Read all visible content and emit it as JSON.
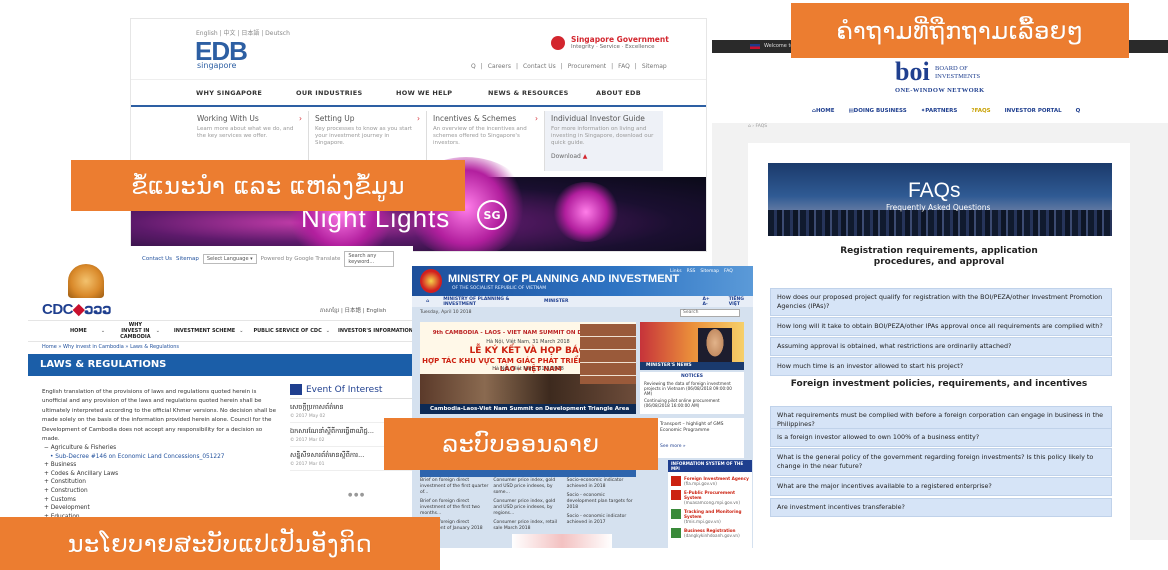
{
  "labels": {
    "faq": "ຄຳຖາມທີ່ຖືກຖາມເລື້ອຍໆ",
    "guide": "ຂໍ້ແນະນຳ ແລະ ແຫລ່ງຂໍ້ມູນ",
    "procedures": "ລະບົບອອນລາຍ",
    "policy": "ນະໂຍບາຍສະບັບແປເປັນອັງກິດ"
  },
  "edb": {
    "languages": "English | 中文 | 日本語 | Deutsch",
    "logo": "EDB",
    "logo_sub": "singapore",
    "gov_title": "Singapore Government",
    "gov_tagline": "Integrity · Service · Excellence",
    "utility_links": [
      "Q",
      "|",
      "Careers",
      "|",
      "Contact Us",
      "|",
      "Procurement",
      "|",
      "FAQ",
      "|",
      "Sitemap"
    ],
    "nav": [
      "WHY SINGAPORE",
      "OUR INDUSTRIES",
      "HOW WE HELP",
      "NEWS & RESOURCES",
      "ABOUT EDB"
    ],
    "menu": [
      {
        "title": "Working With Us",
        "desc": "Learn more about what we do, and the key services we offer."
      },
      {
        "title": "Setting Up",
        "desc": "Key processes to know as you start your investment journey in Singapore."
      },
      {
        "title": "Incentives & Schemes",
        "desc": "An overview of the incentives and schemes offered to Singapore's investors."
      },
      {
        "title": "Individual Investor Guide",
        "desc": "For more information on living and investing in Singapore, download our quick guide.",
        "download": "Download"
      }
    ],
    "banner_title": "Night Lights",
    "banner_badge": "SG"
  },
  "boi": {
    "welcome": "Welcome to the",
    "logo": "boi",
    "logo_text": "BOARD OF INVESTMENTS",
    "network": "ONE-WINDOW NETWORK",
    "nav": [
      "HOME",
      "DOING BUSINESS",
      "PARTNERS",
      "FAQS",
      "INVESTOR PORTAL",
      "Q"
    ],
    "crumb": "⌂ › FAQS",
    "banner_title": "FAQs",
    "banner_sub": "Frequently Asked Questions",
    "section1": "Registration requirements, application procedures, and approval",
    "questions1": [
      "How does our proposed project qualify for registration with the BOI/PEZA/other Investment Promotion Agencies (IPAs)?",
      "How long will it take to obtain BOI/PEZA/other IPAs approval once all requirements are complied with?",
      "Assuming approval is obtained, what restrictions are ordinarily attached?",
      "How much time is an investor allowed to start his project?"
    ],
    "section2": "Foreign investment policies, requirements, and incentives",
    "questions2": [
      "What requirements must be complied with before a foreign corporation can engage in business in the Philippines?",
      "Is a foreign investor allowed to own 100% of a business entity?",
      "What is the general policy of the government regarding foreign investments? Is this policy likely to change in the near future?",
      "What are the major incentives available to a registered enterprise?",
      "Are investment incentives transferable?"
    ]
  },
  "cdc": {
    "util": [
      "Contact Us",
      "Sitemap"
    ],
    "language_select": "Select Language ▾",
    "powered": "Powered by Google Translate",
    "search_placeholder": "Search any keyword...",
    "logo_left": "CDC",
    "logo_right": "ວວວ",
    "langs": "ភាសាខ្មែរ | 日本語 | English",
    "nav": [
      "HOME",
      "WHY INVEST IN CAMBODIA",
      "INVESTMENT SCHEME",
      "PUBLIC SERVICE OF CDC",
      "INVESTOR'S INFORMATION"
    ],
    "crumb": "Home » Why invest in Cambodia » Laws & Regulations",
    "title": "LAWS & REGULATIONS",
    "intro": "English translation of the provisions of laws and regulations quoted herein is unofficial and any provision of the laws and regulations quoted herein shall be ultimately interpreted according to the official Khmer versions. No decision shall be made solely on the basis of the information provided herein alone. Council for the Development of Cambodia does not accept any responsibility for a decision so made.",
    "categories": [
      "Agriculture & Fisheries",
      "Sub-Decree #146 on Economic Land Concessions_051227",
      "Business",
      "Codes & Ancillary Laws",
      "Constitution",
      "Construction",
      "Customs",
      "Development",
      "Education"
    ],
    "event_title": "Event Of Interest",
    "events": [
      {
        "title": "សេចក្តីប្រកាសព័ត៌មាន",
        "date": "© 2017 May 02"
      },
      {
        "title": "ឯកសារណែនាំស្តីពីការធ្វើពាណិជ្ជ...",
        "date": "© 2017 Mar 02"
      },
      {
        "title": "សន្និសីទសារព័ត៌មានស្តីពីការ...",
        "date": "© 2017 Mar 01"
      }
    ],
    "dots": "● ● ●"
  },
  "mpi": {
    "title": "MINISTRY OF PLANNING AND INVESTMENT",
    "subtitle": "OF THE SOCIALIST REPUBLIC OF VIETNAM",
    "top_links": [
      "Links",
      "RSS",
      "Sitemap",
      "FAQ"
    ],
    "nav": [
      "⌂",
      "MINISTRY OF PLANNING & INVESTMENT",
      "MINISTER",
      "A+ A-",
      "TIẾNG VIỆT"
    ],
    "date": "Tuesday, April 10 2018",
    "search_placeholder": "Search",
    "hero_lines": [
      "9th CAMBODIA - LAOS - VIET NAM SUMMIT ON DEVELOPMENT",
      "Hà Nội, Việt Nam, 31 March 2018",
      "LỄ KÝ KẾT VÀ HỌP BÁO",
      "HỢP TÁC KHU VỰC TAM GIÁC PHÁT TRIỂN CAMPUCHIA - LÀO - VIỆT NAM",
      "Hà Nội, Việt Nam, 31/3/2018"
    ],
    "hero_caption": "Cambodia-Laos-Viet Nam Summit on Development Triangle Area",
    "minister_label": "MINISTER'S NEWS",
    "notices_title": "NOTICES",
    "notices": [
      "Reviewing the data of foreign investment projects in Vietnam (06/08/2018 09:00:00 AM)",
      "Continuing pilot online procurement (06/08/2018 16:00:00 AM)"
    ],
    "right_links": [
      "Transport – highlight of GMS Economic Programme",
      "See more »"
    ],
    "col1": [
      "Brief on foreign direct investment of the first quarter of...",
      "Brief on foreign direct investment of the first two months...",
      "Brief on foreign direct investment of January 2018"
    ],
    "col2": [
      "Consumer price index, gold and USD price indexes, by some...",
      "Consumer price index, gold and USD price indexes, by regions...",
      "Consumer price index, retail sale March 2018"
    ],
    "col3": [
      "Socio-economic indicator achieved in 2018",
      "Socio - economic development plan targets for 2018",
      "Socio - economic indicator achieved in 2017"
    ],
    "systems_title": "INFORMATION SYSTEM OF THE MPI",
    "systems": [
      {
        "name": "Foreign Investment Agency",
        "url": "(fia.mpi.gov.vn)"
      },
      {
        "name": "E-Public Procurement System",
        "url": "(muasamcong.mpi.gov.vn)"
      },
      {
        "name": "Tracking and Monitoring System",
        "url": "(tmis.mpi.gov.vn)"
      },
      {
        "name": "Business Registration",
        "url": "(dangkykinhdoanh.gov.vn)"
      }
    ]
  }
}
